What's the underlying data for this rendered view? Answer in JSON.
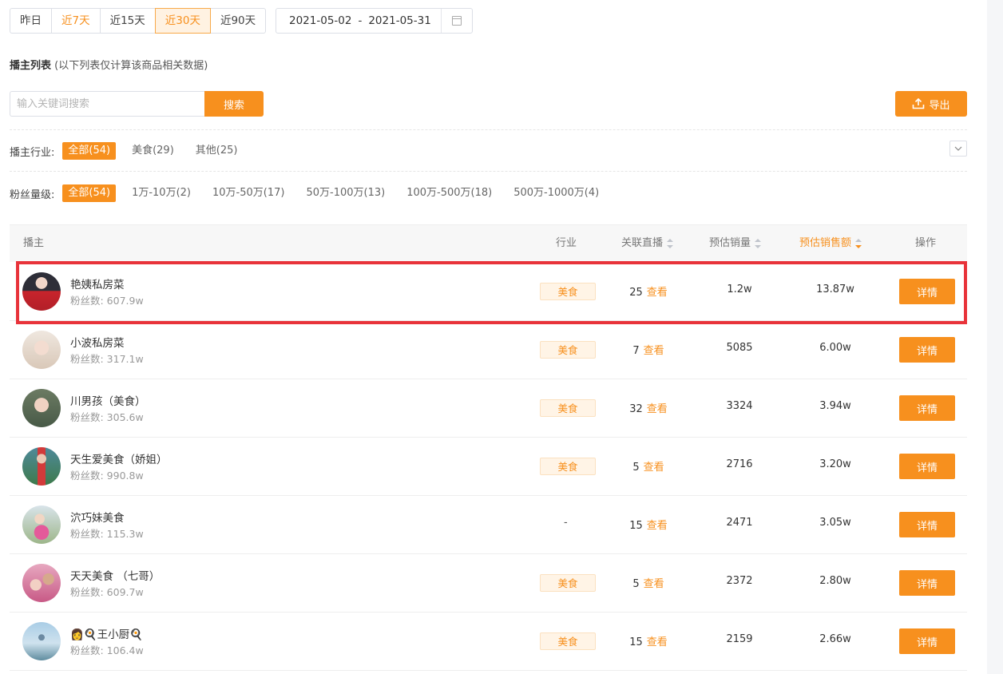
{
  "date_ranges": [
    "昨日",
    "近7天",
    "近15天",
    "近30天",
    "近90天"
  ],
  "date_picker": {
    "start": "2021-05-02",
    "separator": "-",
    "end": "2021-05-31"
  },
  "section": {
    "title": "播主列表",
    "note": "(以下列表仅计算该商品相关数据)"
  },
  "search": {
    "placeholder": "输入关键词搜索",
    "button": "搜索"
  },
  "export_label": "导出",
  "industry_filter": {
    "label": "播主行业:",
    "options": [
      "全部(54)",
      "美食(29)",
      "其他(25)"
    ]
  },
  "fans_filter": {
    "label": "粉丝量级:",
    "options": [
      "全部(54)",
      "1万-10万(2)",
      "10万-50万(17)",
      "50万-100万(13)",
      "100万-500万(18)",
      "500万-1000万(4)"
    ]
  },
  "table": {
    "headers": {
      "anchor": "播主",
      "industry": "行业",
      "live": "关联直播",
      "sales": "预估销量",
      "amount": "预估销售额",
      "action": "操作"
    },
    "view_label": "查看",
    "detail_label": "详情",
    "rows": [
      {
        "name": "艳姨私房菜",
        "fans": "粉丝数: 607.9w",
        "industry": "美食",
        "live": "25",
        "sales": "1.2w",
        "amount": "13.87w"
      },
      {
        "name": "小波私房菜",
        "fans": "粉丝数: 317.1w",
        "industry": "美食",
        "live": "7",
        "sales": "5085",
        "amount": "6.00w"
      },
      {
        "name": "川男孩（美食）",
        "fans": "粉丝数: 305.6w",
        "industry": "美食",
        "live": "32",
        "sales": "3324",
        "amount": "3.94w"
      },
      {
        "name": "天生爱美食（娇姐）",
        "fans": "粉丝数: 990.8w",
        "industry": "美食",
        "live": "5",
        "sales": "2716",
        "amount": "3.20w"
      },
      {
        "name": "泬巧妹美食",
        "fans": "粉丝数: 115.3w",
        "industry": "-",
        "live": "15",
        "sales": "2471",
        "amount": "3.05w"
      },
      {
        "name": "天天美食 （七哥）",
        "fans": "粉丝数: 609.7w",
        "industry": "美食",
        "live": "5",
        "sales": "2372",
        "amount": "2.80w"
      },
      {
        "name": "👩🍳王小厨🍳",
        "fans": "粉丝数: 106.4w",
        "industry": "美食",
        "live": "15",
        "sales": "2159",
        "amount": "2.66w"
      }
    ]
  },
  "colors": {
    "accent": "#f7901e",
    "highlight": "#e8333a"
  }
}
